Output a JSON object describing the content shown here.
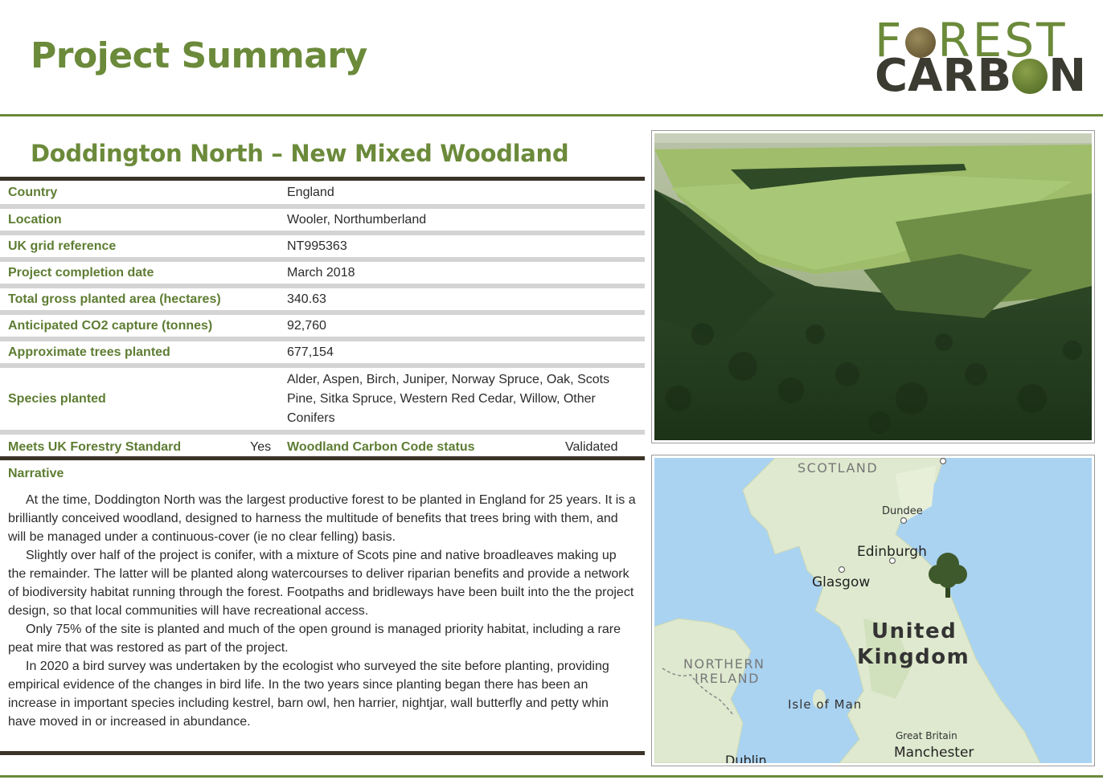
{
  "header": {
    "page_title": "Project Summary",
    "logo_line1": "FOREST",
    "logo_line2": "CARBON"
  },
  "project": {
    "title": "Doddington North – New Mixed Woodland"
  },
  "details": [
    {
      "label": "Country",
      "value": "England"
    },
    {
      "label": "Location",
      "value": "Wooler, Northumberland"
    },
    {
      "label": "UK grid reference",
      "value": "NT995363"
    },
    {
      "label": "Project completion date",
      "value": "March 2018"
    },
    {
      "label": "Total gross planted area (hectares)",
      "value": "340.63"
    },
    {
      "label": "Anticipated CO2 capture (tonnes)",
      "value": "92,760"
    },
    {
      "label": "Approximate trees planted",
      "value": "677,154"
    },
    {
      "label": "Species planted",
      "value": "Alder, Aspen, Birch, Juniper, Norway Spruce, Oak, Scots Pine, Sitka Spruce, Western Red Cedar, Willow, Other Conifers"
    }
  ],
  "standards": {
    "ufs_label": "Meets UK Forestry Standard",
    "ufs_value": "Yes",
    "wcc_label": "Woodland Carbon Code status",
    "wcc_value": "Validated"
  },
  "narrative": {
    "heading": "Narrative",
    "paragraphs": [
      "At the time, Doddington North was the largest productive forest to be planted in England for 25 years. It is a brilliantly conceived woodland, designed to harness the multitude of benefits that trees bring with them, and will be managed under a continuous-cover (ie no clear felling) basis.",
      "Slightly over half of the project is conifer, with a mixture of Scots pine and native broadleaves making up the remainder. The latter will be planted along watercourses to deliver riparian benefits and provide a network of biodiversity habitat running through the forest. Footpaths and bridleways have been built into the the project design, so that local communities will have recreational access.",
      "Only 75% of the site is planted and much of the open ground is managed priority habitat, including a rare peat mire that was restored as part of the project.",
      "In 2020 a bird survey was undertaken by the ecologist who surveyed the site before planting, providing empirical evidence of the changes in bird life. In the two years since planting began there has been an increase in important species including kestrel, barn owl, hen harrier, nightjar, wall butterfly and petty whin have moved in or increased in abundance."
    ]
  },
  "map": {
    "labels": {
      "scotland": "SCOTLAND",
      "dundee": "Dundee",
      "edinburgh": "Edinburgh",
      "glasgow": "Glasgow",
      "uk_line1": "United",
      "uk_line2": "Kingdom",
      "northern_line1": "NORTHERN",
      "northern_line2": "IRELAND",
      "isle_of_man": "Isle of Man",
      "great_britain": "Great Britain",
      "manchester": "Manchester",
      "dublin": "Dublin"
    },
    "colors": {
      "sea": "#aad3f2",
      "land": "#dfe9cf",
      "marker": "#3e5a2c"
    },
    "marker_icon": "tree-marker-icon"
  },
  "colors": {
    "brand_green": "#6b8a3a",
    "dark_rule": "#3a3327",
    "row_rule": "#d4d4d4"
  }
}
